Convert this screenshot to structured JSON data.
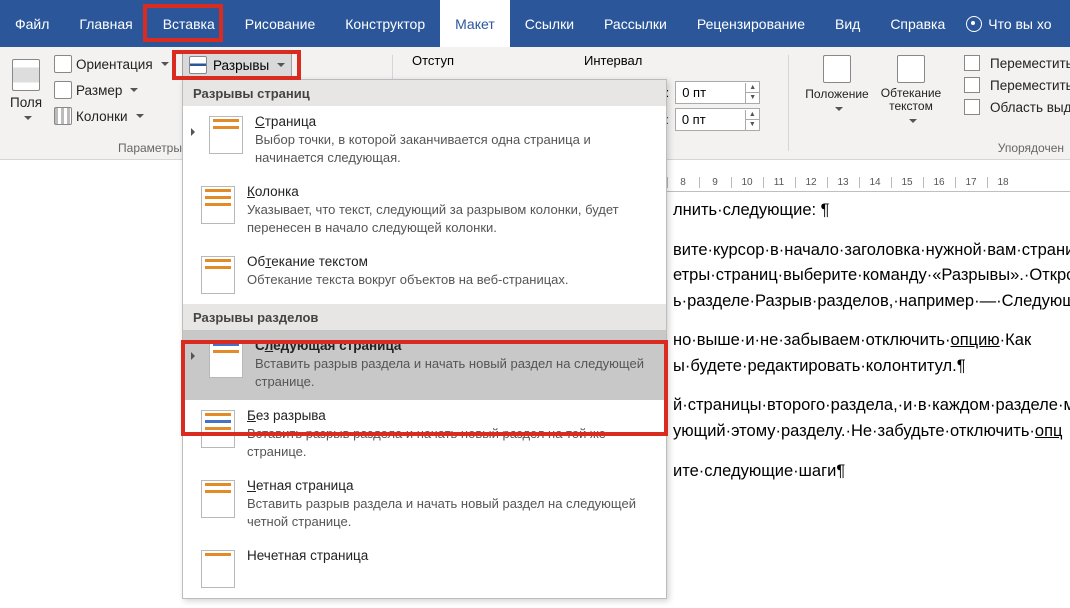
{
  "menubar": {
    "items": [
      "Файл",
      "Главная",
      "Вставка",
      "Рисование",
      "Конструктор",
      "Макет",
      "Ссылки",
      "Рассылки",
      "Рецензирование",
      "Вид",
      "Справка"
    ],
    "active_index": 5,
    "tell_me": "Что вы хо"
  },
  "ribbon": {
    "page_setup": {
      "margins": "Поля",
      "orientation": "Ориентация",
      "size": "Размер",
      "columns": "Колонки",
      "breaks": "Разрывы",
      "group_label": "Параметры"
    },
    "paragraph": {
      "indent_label": "Отступ",
      "spacing_label": "Интервал",
      "left_prefix": "д:",
      "right_prefix": "е:",
      "spacing_before": "0 пт",
      "spacing_after": "0 пт"
    },
    "arrange": {
      "position": "Положение",
      "wrap": "Обтекание текстом",
      "forward": "Переместить",
      "backward": "Переместить",
      "selection": "Область выд",
      "group_label": "Упорядочен"
    }
  },
  "dropdown": {
    "section1": "Разрывы страниц",
    "section2": "Разрывы разделов",
    "items": [
      {
        "title_pre": "",
        "title_u": "С",
        "title_post": "траница",
        "desc": "Выбор точки, в которой заканчивается одна страница и начинается следующая."
      },
      {
        "title_pre": "",
        "title_u": "К",
        "title_post": "олонка",
        "desc": "Указывает, что текст, следующий за разрывом колонки, будет перенесен в начало следующей колонки."
      },
      {
        "title_pre": "Об",
        "title_u": "т",
        "title_post": "екание текстом",
        "desc": "Обтекание текста вокруг объектов на веб-страницах."
      },
      {
        "title_pre": "С",
        "title_u": "л",
        "title_post": "едующая страница",
        "desc": "Вставить разрыв раздела и начать новый раздел на следующей странице."
      },
      {
        "title_pre": "",
        "title_u": "Б",
        "title_post": "ез разрыва",
        "desc": "Вставить разрыв раздела и начать новый раздел на той же странице."
      },
      {
        "title_pre": "",
        "title_u": "Ч",
        "title_post": "етная страница",
        "desc": "Вставить разрыв раздела и начать новый раздел на следующей четной странице."
      },
      {
        "title_pre": "Нечетная страница",
        "title_u": "",
        "title_post": "",
        "desc": ""
      }
    ]
  },
  "ruler_marks": [
    "8",
    "9",
    "10",
    "11",
    "12",
    "13",
    "14",
    "15",
    "16",
    "17",
    "18"
  ],
  "doc": {
    "p1": "лнить·следующие: ¶",
    "p2a": "вите·курсор·в·начало·заголовка·нужной·вам·страни",
    "p2b": "етры·страниц·выберите·команду·«Разрывы».·Открое",
    "p2c": "ь·разделе·Разрыв·разделов,·например·—·Следующ",
    "p3a": "но·выше·и·не·забываем·отключить·",
    "p3b": "опцию",
    "p3c": "·Как",
    "p3d": "ы·будете·редактировать·колонтитул.¶",
    "p4a": "й·страницы·второго·раздела,·и·в·каждом·разделе·мож",
    "p4b": "ующий·этому·разделу.·Не·забудьте·отключить·",
    "p4c": "опц",
    "p5": "ите·следующие·шаги¶"
  }
}
